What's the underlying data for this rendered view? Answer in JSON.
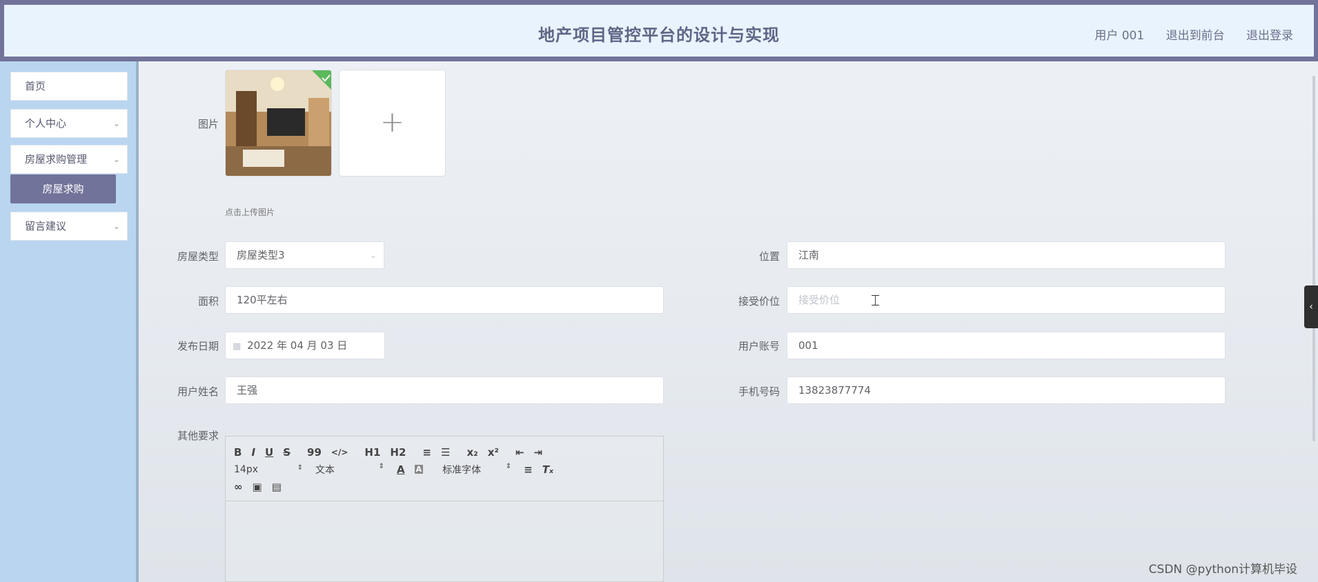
{
  "header": {
    "title": "地产项目管控平台的设计与实现",
    "user": "用户 001",
    "back_front": "退出到前台",
    "logout": "退出登录"
  },
  "sidebar": {
    "items": [
      {
        "label": "首页"
      },
      {
        "label": "个人中心"
      },
      {
        "label": "房屋求购管理"
      },
      {
        "label": "留言建议"
      }
    ],
    "submenu_active": "房屋求购"
  },
  "form": {
    "image_label": "图片",
    "upload_hint": "点击上传图片",
    "upload_plus": "+",
    "house_type_label": "房屋类型",
    "house_type_value": "房屋类型3",
    "location_label": "位置",
    "location_value": "江南",
    "area_label": "面积",
    "area_value": "120平左右",
    "price_label": "接受价位",
    "price_placeholder": "接受价位",
    "date_label": "发布日期",
    "date_value": "2022 年 04 月 03 日",
    "account_label": "用户账号",
    "account_value": "001",
    "name_label": "用户姓名",
    "name_value": "王强",
    "phone_label": "手机号码",
    "phone_value": "13823877774",
    "other_label": "其他要求"
  },
  "editor": {
    "row1": [
      "B",
      "I",
      "U",
      "S",
      "99",
      "</>",
      "H1",
      "H2",
      "≡",
      "☰",
      "x₂",
      "x²",
      "⇤",
      "⇥"
    ],
    "font_size": "14px",
    "header_select": "文本",
    "font_family": "标准字体"
  },
  "watermark": "CSDN @python计算机毕设",
  "colors": {
    "accent": "#72739a",
    "sidebar_bg": "#b9d5f0",
    "header_bg": "#e8f3fd"
  }
}
